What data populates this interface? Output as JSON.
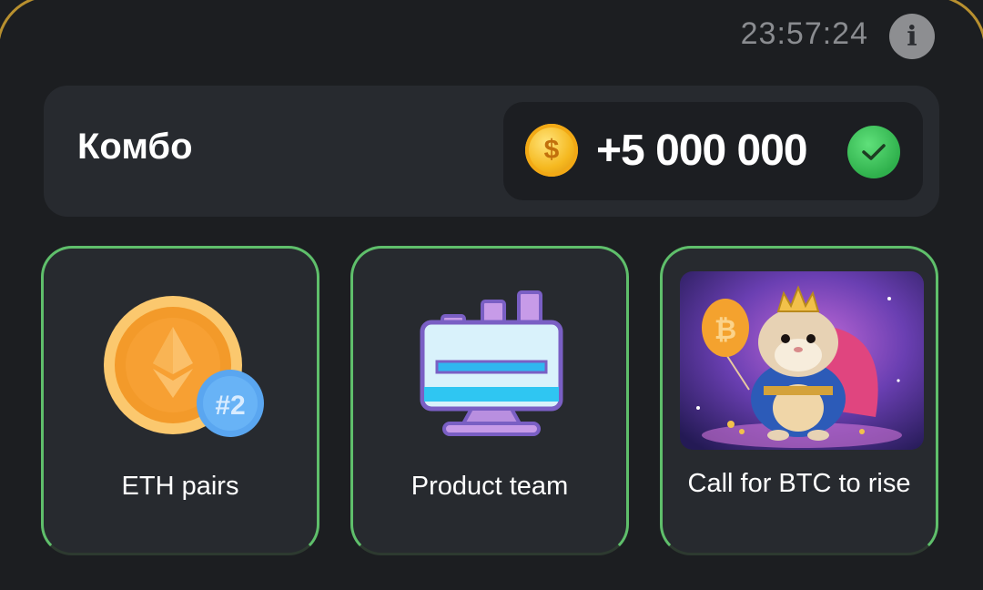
{
  "header": {
    "timer": "23:57:24",
    "info_icon": "info-icon"
  },
  "combo": {
    "title": "Комбо",
    "reward_amount": "+5 000 000",
    "coin_icon": "dollar-coin-icon",
    "status_icon": "check-icon"
  },
  "cards": [
    {
      "label": "ETH pairs",
      "icon": "eth-coin-icon",
      "badge": "#2"
    },
    {
      "label": "Product team",
      "icon": "monitor-chart-icon"
    },
    {
      "label": "Call for BTC to rise",
      "icon": "hamster-king-image"
    }
  ],
  "colors": {
    "background": "#1c1e21",
    "card": "#272a2f",
    "card_border": "#5fbf6b",
    "check_green": "#2fb04c",
    "coin_gold": "#f5b81f"
  }
}
